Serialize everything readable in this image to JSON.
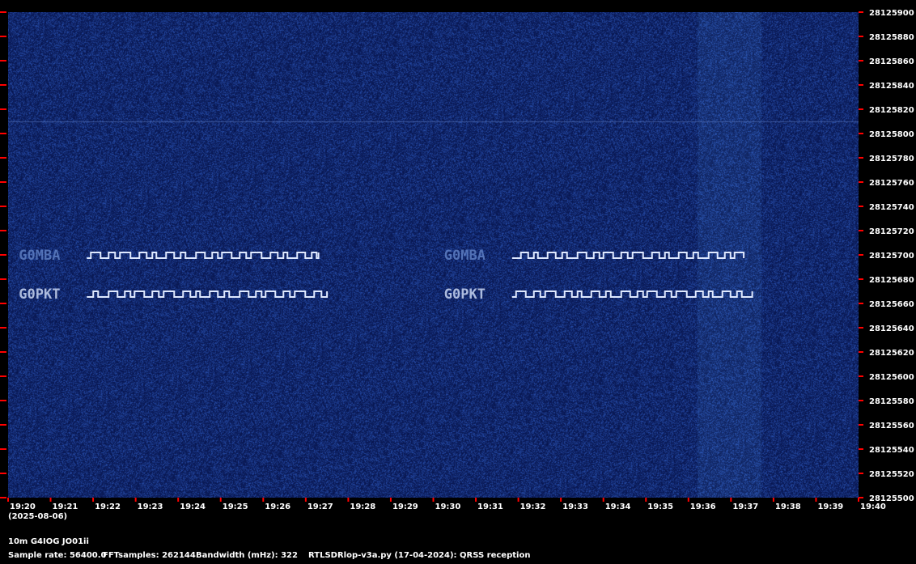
{
  "chart_data": {
    "type": "heatmap",
    "x_ticks": [
      "19:20",
      "19:21",
      "19:22",
      "19:23",
      "19:24",
      "19:25",
      "19:26",
      "19:27",
      "19:28",
      "19:29",
      "19:30",
      "19:31",
      "19:32",
      "19:33",
      "19:34",
      "19:35",
      "19:36",
      "19:37",
      "19:38",
      "19:39",
      "19:40"
    ],
    "y_ticks": [
      28125500,
      28125520,
      28125540,
      28125560,
      28125580,
      28125600,
      28125620,
      28125640,
      28125660,
      28125680,
      28125700,
      28125720,
      28125740,
      28125760,
      28125780,
      28125800,
      28125820,
      28125840,
      28125860,
      28125880,
      28125900
    ],
    "xlim_minutes": [
      0,
      20
    ],
    "ylim": [
      28125500,
      28125900
    ],
    "colors": {
      "background": "#0b1a5c",
      "noise": "#1a3488",
      "signal": "#dfe9ff",
      "tick": "#ff0000"
    },
    "signals": [
      {
        "label": "G0MBA",
        "freq": 28125700,
        "start_min": 0.1,
        "end_min": 7.3
      },
      {
        "label": "G0PKT",
        "freq": 28125668,
        "start_min": 0.1,
        "end_min": 7.5
      },
      {
        "label": "G0MBA",
        "freq": 28125700,
        "start_min": 10.1,
        "end_min": 17.3
      },
      {
        "label": "G0PKT",
        "freq": 28125668,
        "start_min": 10.1,
        "end_min": 17.5
      }
    ],
    "noise_band_min": [
      16.2,
      17.7
    ],
    "carrier_freq": 28125810
  },
  "info": {
    "date": "(2025-08-06)",
    "station": "10m G4IOG JO01ii",
    "sample_rate": "Sample rate: 56400.0",
    "fft_samples": "FFTsamples: 262144",
    "bandwidth": "Bandwidth (mHz): 322",
    "software": "RTLSDRlop-v3a.py (17-04-2024): QRSS reception"
  }
}
